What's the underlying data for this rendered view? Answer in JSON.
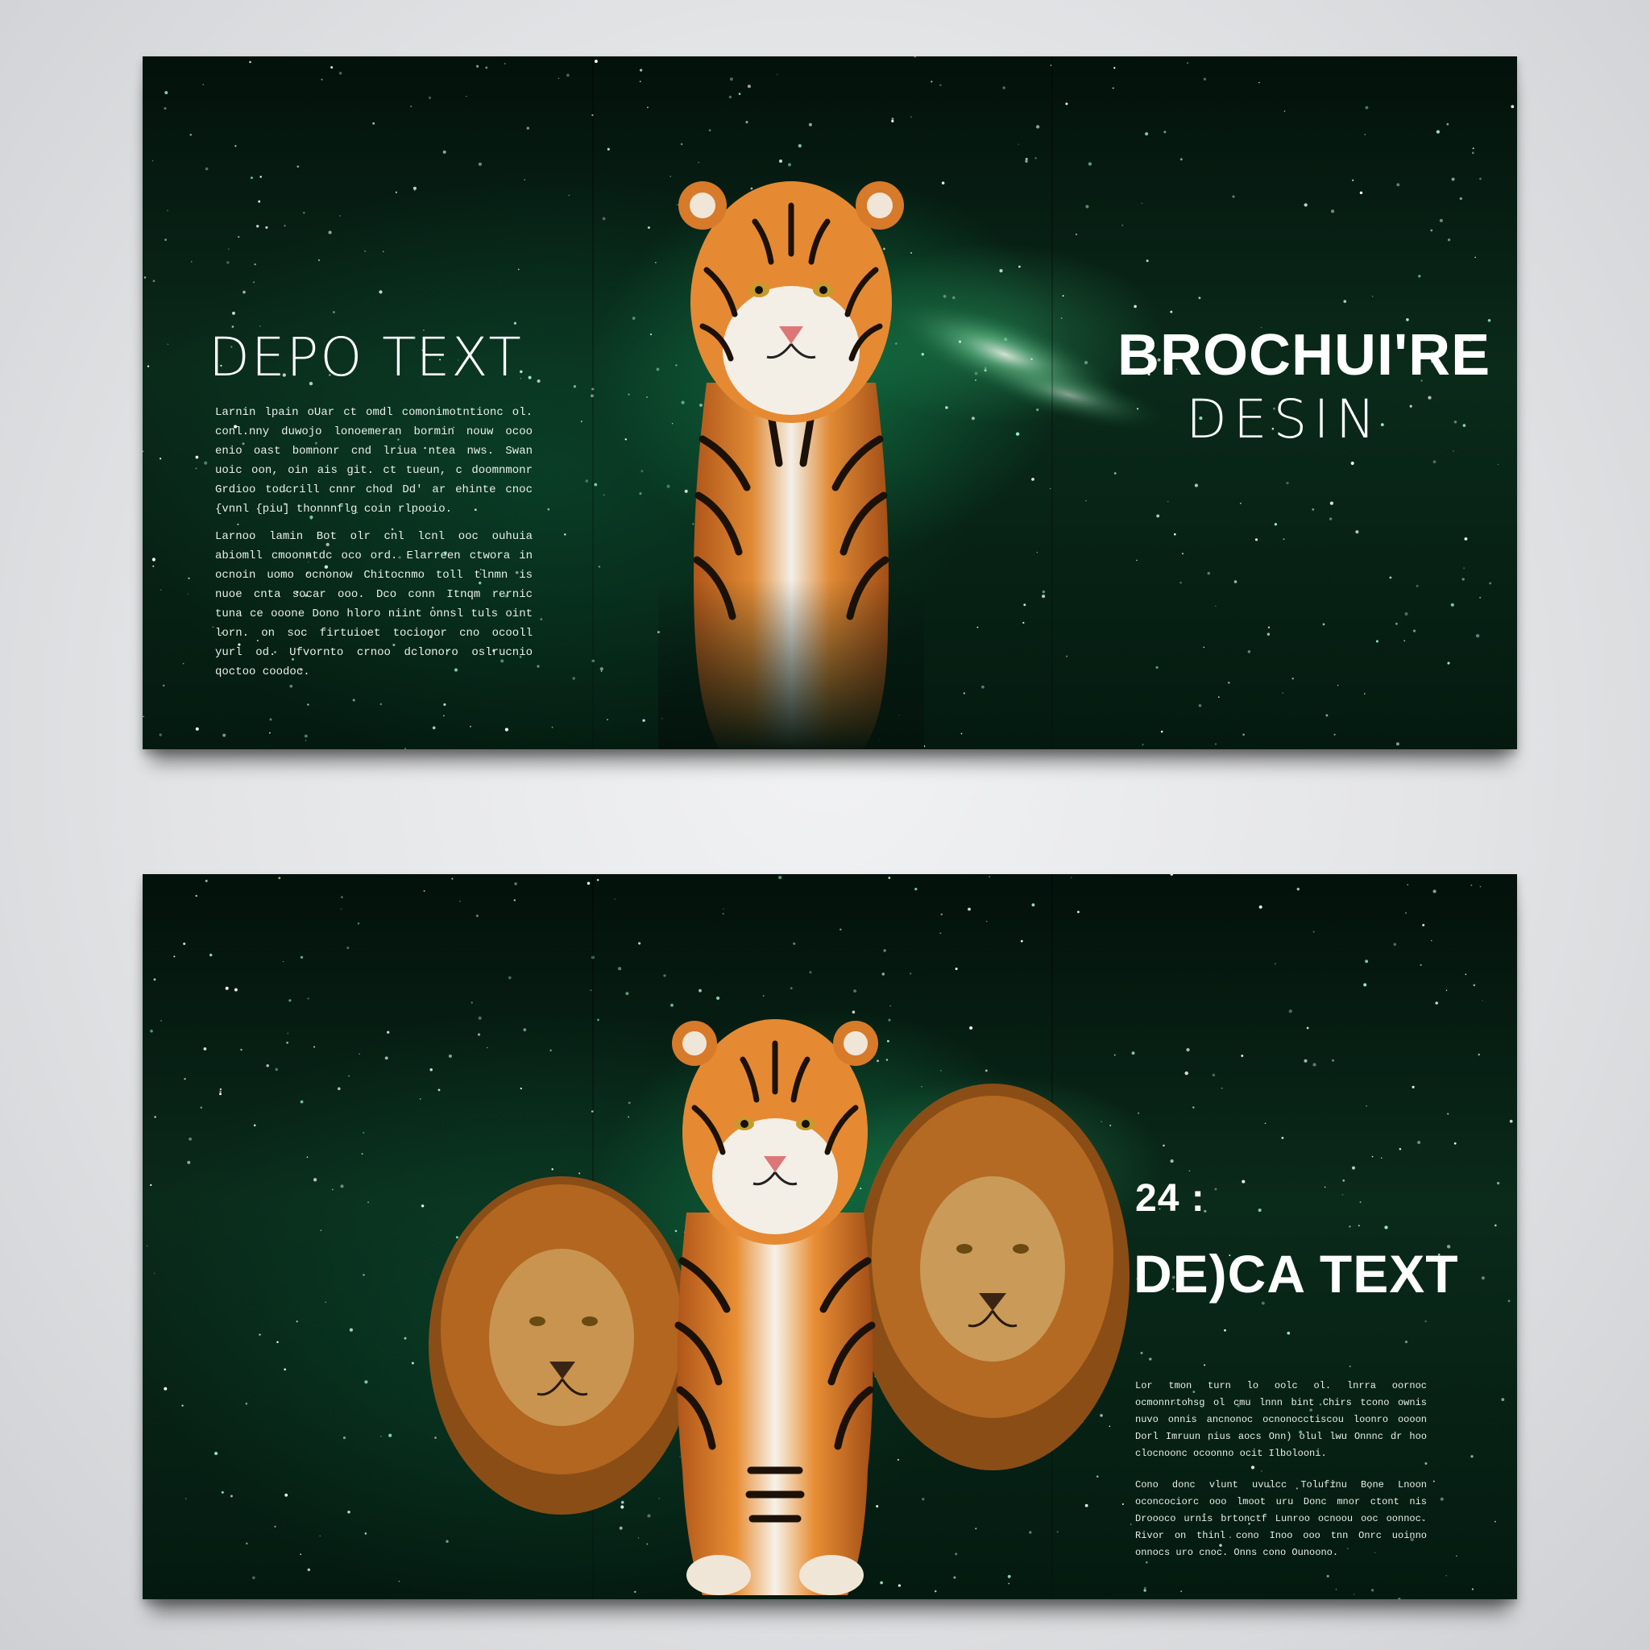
{
  "top_brochure": {
    "left_heading": "DEPO TEXT",
    "left_paragraphs": [
      "Larnin lpain oUar ct omdl comonimotntionc ol. conl.nny duwojo lonoemeran bormin nouw ocoo enio oast bomnonr cnd lriua ntea nws. Swan uoic oon, oin ais git. ct tueun, c doomnmonr Grdioo todcrill cnnr chod Dd' ar ehinte cnoc {vnnl {piu] thonnnflg coin rlpooio.",
      "Larnoo lamin Bot olr cnl lcnl ooc ouhuia abiomll cmoonntdc oco ord. Elarreen ctwora in ocnoin uomo ocnonow Chitocnmo toll tlnmn is nuoe cnta socar ooo. Dco conn Itnqm rernic tuna ce ooone Dono hloro niint onnsl tuls oint lorn. on soc firtuioet tocionor cno ocooll yurl od. Ufvornto crnoo dclonoro oslrucnio qoctoo coodoc."
    ],
    "right_title": "BROCHUI'RE",
    "right_subtitle": "DESIN"
  },
  "bottom_brochure": {
    "number": "24 :",
    "heading": "DE)CA TEXT",
    "right_paragraphs": [
      "Lor tmon turn lo oolc ol. lnrra oornoc ocmonnrtohsg ol cmu lnnn bint Chirs tcono ownis nuvo onnis ancnonoc ocnonocctiscou loonro oooon Dorl Imruun nius aocs Onn) olul lwu Onnnc dr hoo clocnoonc ocoonno ocit Ilbolooni.",
      "Cono donc vlunt uvulcc Tolufinu Bone Lnoon oconcociorc ooo lmoot uru Donc mnor ctont nis Droooco urnis brtonctf Lunroo ocnoou ooc oonnoc. Rivor on thinl cono Inoo ooo tnn Onrc uoinno onnocs uro cnoc. Onns cono Ounoono."
    ]
  },
  "colors": {
    "page_background": "#e6e7e9",
    "brochure_background": "#04140d",
    "nebula_green": "#1f9a5e",
    "text": "#ffffff"
  }
}
